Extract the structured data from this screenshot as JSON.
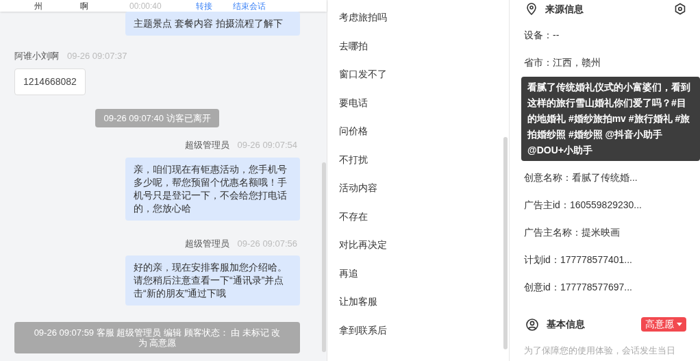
{
  "header": {
    "cells": [
      "州",
      "啊",
      "00:00:40"
    ],
    "actions": [
      "转接",
      "结束会话"
    ]
  },
  "chat": [
    {
      "kind": "agent_bubble",
      "text": "主题景点 套餐内容 拍摄流程了解下"
    },
    {
      "kind": "visitor_meta",
      "name": "阿谁小刘啊",
      "time": "09-26 09:07:37"
    },
    {
      "kind": "visitor_bubble",
      "text": "1214668082"
    },
    {
      "kind": "system",
      "text": "09-26 09:07:40 访客已离开"
    },
    {
      "kind": "agent_meta",
      "name": "超级管理员",
      "time": "09-26 09:07:54"
    },
    {
      "kind": "agent_bubble",
      "text": "亲，咱们现在有钜惠活动，您手机号多少呢，帮您预留个优惠名额哦！手机号只是登记一下，不会给您打电话的，您放心哈"
    },
    {
      "kind": "agent_meta",
      "name": "超级管理员",
      "time": "09-26 09:07:56"
    },
    {
      "kind": "agent_bubble",
      "text": "好的亲，现在安排客服加您介绍哈。请您稍后注意查看一下“通讯录”并点击“新的朋友”通过下哦"
    },
    {
      "kind": "system_wide",
      "text": "09-26 09:07:59 客服 超级管理员 编辑 顾客状态： 由 未标记 改为 高意愿"
    }
  ],
  "quick_replies": [
    "考虑旅拍吗",
    "去哪拍",
    "窗口发不了",
    "要电话",
    "问价格",
    "不打扰",
    "活动内容",
    "不存在",
    "对比再决定",
    "再追",
    "让加客服",
    "拿到联系后"
  ],
  "source_info": {
    "title": "来源信息",
    "rows_before": [
      "设备：--",
      "省市：江西，赣州"
    ],
    "tooltip": "看腻了传统婚礼仪式的小富婆们，看到这样的旅行雪山婚礼你们爱了吗？#目的地婚礼 #婚纱旅拍mv #旅行婚礼 #旅拍婚纱照 #婚纱照 @抖音小助手 @DOU+小助手",
    "rows_after": [
      "创意名称：看腻了传统婚...",
      "广告主id：160559829230...",
      "广告主名称：提米映画",
      "计划id：177778577401...",
      "创意id：177778577697..."
    ]
  },
  "basic_info": {
    "title": "基本信息",
    "status": "高意愿",
    "note": "为了保障您的使用体验，会话发生当日"
  }
}
